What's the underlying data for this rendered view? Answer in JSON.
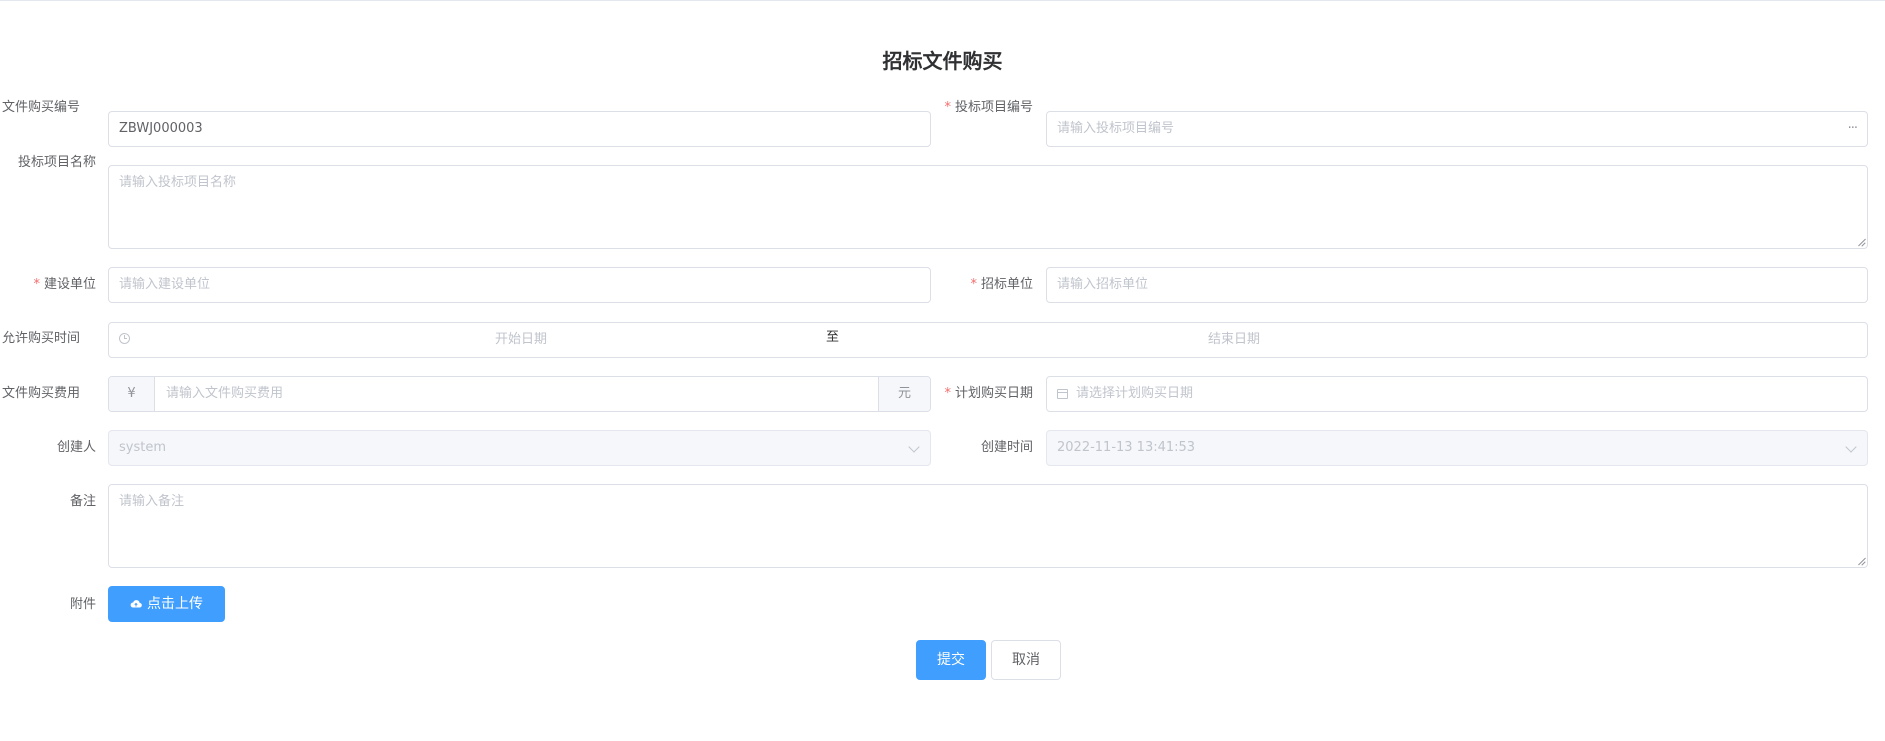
{
  "page": {
    "title": "招标文件购买"
  },
  "form": {
    "doc_no": {
      "label": "文件购买编号",
      "value": "ZBWJ000003",
      "required": true
    },
    "project_no": {
      "label": "投标项目编号",
      "placeholder": "请输入投标项目编号",
      "required": true,
      "more_icon": "more-dots-icon"
    },
    "project_name": {
      "label": "投标项目名称",
      "placeholder": "请输入投标项目名称",
      "required": false
    },
    "construction_unit": {
      "label": "建设单位",
      "placeholder": "请输入建设单位",
      "required": true
    },
    "tender_unit": {
      "label": "招标单位",
      "placeholder": "请输入招标单位",
      "required": true
    },
    "allowed_time": {
      "label": "允许购买时间",
      "start_placeholder": "开始日期",
      "separator": "至",
      "end_placeholder": "结束日期",
      "required": true,
      "icon": "clock-icon"
    },
    "fee": {
      "label": "文件购买费用",
      "prefix": "¥",
      "placeholder": "请输入文件购买费用",
      "suffix": "元",
      "required": true
    },
    "planned_date": {
      "label": "计划购买日期",
      "placeholder": "请选择计划购买日期",
      "required": true,
      "icon": "calendar-icon"
    },
    "creator": {
      "label": "创建人",
      "value": "system",
      "disabled": true
    },
    "created_time": {
      "label": "创建时间",
      "value": "2022-11-13 13:41:53",
      "disabled": true
    },
    "remark": {
      "label": "备注",
      "placeholder": "请输入备注"
    },
    "attachment": {
      "label": "附件",
      "upload_label": "点击上传",
      "icon": "cloud-upload-icon"
    }
  },
  "actions": {
    "submit": "提交",
    "cancel": "取消"
  },
  "colors": {
    "primary": "#409eff",
    "required": "#f56c6c",
    "border": "#dcdfe6",
    "disabled_bg": "#f5f7fa"
  }
}
